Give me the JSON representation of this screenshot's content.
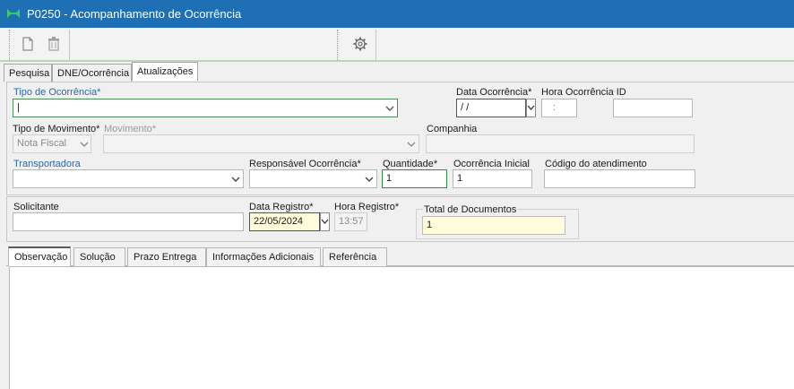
{
  "window": {
    "title": "P0250 - Acompanhamento de Ocorrência",
    "accent": "#1f6fb5"
  },
  "toolbar": {
    "icons": [
      "new-file-icon",
      "delete-icon",
      "settings-icon"
    ]
  },
  "tabs": [
    {
      "label": "Pesquisa"
    },
    {
      "label": "DNE/Ocorrência"
    },
    {
      "label": "Atualizações"
    }
  ],
  "form": {
    "tipo_ocorrencia": {
      "label": "Tipo de Ocorrência*",
      "value": "|"
    },
    "data_ocorrencia": {
      "label": "Data Ocorrência*",
      "value": " / /"
    },
    "hora_ocorrencia_id": {
      "label": "Hora Ocorrência ID",
      "value": ":"
    },
    "tipo_movimento": {
      "label": "Tipo de Movimento*",
      "value": "Nota Fiscal"
    },
    "movimento": {
      "label": "Movimento*",
      "value": ""
    },
    "companhia": {
      "label": "Companhia",
      "value": ""
    },
    "transportadora": {
      "label": "Transportadora",
      "value": ""
    },
    "responsavel": {
      "label": "Responsável Ocorrência*",
      "value": ""
    },
    "quantidade": {
      "label": "Quantidade*",
      "value": "1"
    },
    "ocorrencia_inicial": {
      "label": "Ocorrência Inicial",
      "value": "1"
    },
    "codigo_atendimento": {
      "label": "Código do atendimento",
      "value": ""
    },
    "solicitante": {
      "label": "Solicitante",
      "value": ""
    },
    "data_registro": {
      "label": "Data Registro*",
      "value": "22/05/2024"
    },
    "hora_registro": {
      "label": "Hora Registro*",
      "value": "13:57"
    },
    "total_documentos": {
      "label": "Total de Documentos",
      "value": "1"
    }
  },
  "subtabs": [
    {
      "label": "Observação"
    },
    {
      "label": "Solução"
    },
    {
      "label": "Prazo Entrega"
    },
    {
      "label": "Informações Adicionais"
    },
    {
      "label": "Referência"
    }
  ]
}
